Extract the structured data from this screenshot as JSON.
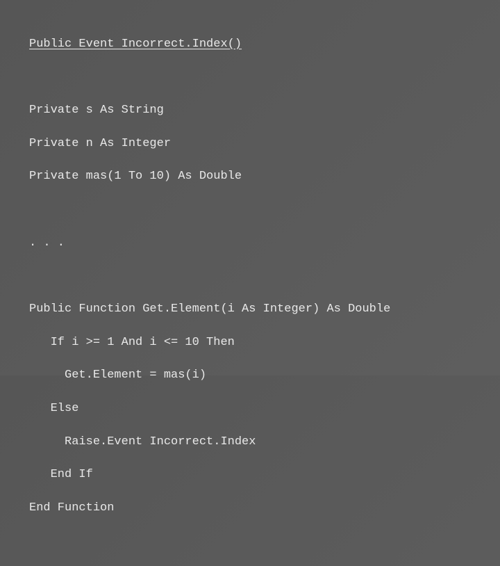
{
  "code": {
    "event_declaration": "Public Event Incorrect.Index()",
    "private_declarations": [
      "Private s As String",
      "Private n As Integer",
      "Private mas(1 To 10) As Double"
    ],
    "ellipsis": ". . .",
    "function_lines": [
      "Public Function Get.Element(i As Integer) As Double",
      "   If i >= 1 And i <= 10 Then",
      "     Get.Element = mas(i)",
      "   Else",
      "     Raise.Event Incorrect.Index",
      "   End If",
      "End Function"
    ]
  }
}
